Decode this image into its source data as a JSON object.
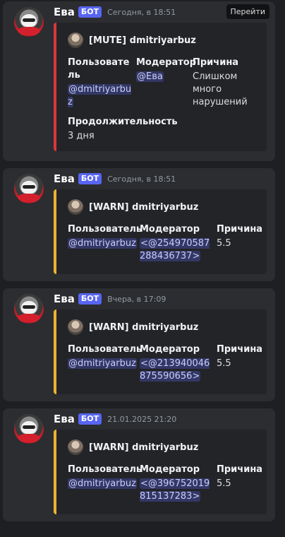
{
  "messages": [
    {
      "author": "Ева",
      "bot_badge": "БОТ",
      "time": "Сегодня, в 18:51",
      "goto": "Перейти",
      "embed_title": "[MUTE] dmitriyarbuz",
      "color": "#da373c",
      "fields": {
        "user_label": "Пользователь",
        "user_value": "@dmitriyarbuz",
        "mod_label": "Модератор",
        "mod_value": "@Ева",
        "reason_label": "Причина",
        "reason_value": "Слишком много нарушений",
        "duration_label": "Продолжительность",
        "duration_value": "3 дня"
      }
    },
    {
      "author": "Ева",
      "bot_badge": "БОТ",
      "time": "Сегодня, в 18:51",
      "embed_title": "[WARN] dmitriyarbuz",
      "color": "#f0b232",
      "fields": {
        "user_label": "Пользователь",
        "user_value": "@dmitriyarbuz",
        "mod_label": "Модератор",
        "mod_value": "<@254970587288436737>",
        "reason_label": "Причина",
        "reason_value": "5.5"
      }
    },
    {
      "author": "Ева",
      "bot_badge": "БОТ",
      "time": "Вчера, в 17:09",
      "embed_title": "[WARN] dmitriyarbuz",
      "color": "#f0b232",
      "fields": {
        "user_label": "Пользователь",
        "user_value": "@dmitriyarbuz",
        "mod_label": "Модератор",
        "mod_value": "<@213940046875590656>",
        "reason_label": "Причина",
        "reason_value": "5.5"
      }
    },
    {
      "author": "Ева",
      "bot_badge": "БОТ",
      "time": "21.01.2025 21:20",
      "embed_title": "[WARN] dmitriyarbuz",
      "color": "#f0b232",
      "fields": {
        "user_label": "Пользователь",
        "user_value": "@dmitriyarbuz",
        "mod_label": "Модератор",
        "mod_value": "<@396752019815137283>",
        "reason_label": "Причина",
        "reason_value": "5.5"
      }
    }
  ]
}
